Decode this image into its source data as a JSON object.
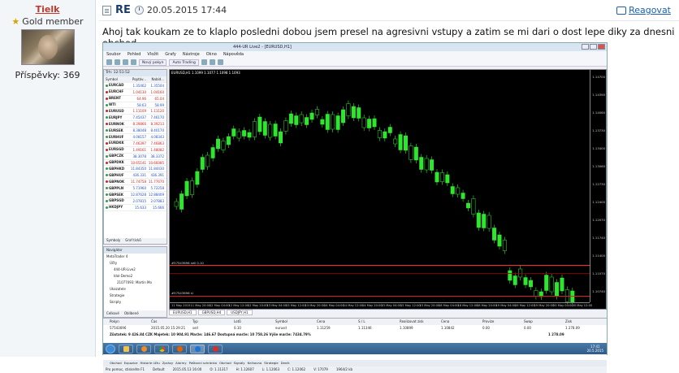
{
  "user": {
    "name": "Tielk",
    "rank": "Gold member",
    "posts_label": "Příspěvky: 369"
  },
  "post": {
    "prefix": "RE",
    "date": "20.05.2015 17:44",
    "reply_label": "Reagovat",
    "message": "Ahoj tak koukam ze to klaplo posledni dobou jsem presel na agresivni vstupy a zatim se mi dari o dost lepe diky za dnesni obchod."
  },
  "mt4": {
    "window_title": "444-UR Live2 - [EURUSD,H1]",
    "menu": [
      "Soubor",
      "Pohled",
      "Vložit",
      "Grafy",
      "Nástroje",
      "Okno",
      "Nápověda"
    ],
    "toolbar_buttons": [
      "Nový pokyn",
      "Auto Trading"
    ],
    "market_watch": {
      "header": "Trh: 12:51:52",
      "columns": [
        "Symbol",
        "Poptáv...",
        "Nabíd..."
      ],
      "rows": [
        {
          "symbol": "EURCAD",
          "bid": "1.35462",
          "ask": "1.35504",
          "dir": "up"
        },
        {
          "symbol": "EURCHF",
          "bid": "1.04130",
          "ask": "1.04160",
          "dir": "down"
        },
        {
          "symbol": "BRENT",
          "bid": "64.96",
          "ask": "65.04",
          "dir": "down"
        },
        {
          "symbol": "WTI",
          "bid": "58.63",
          "ask": "58.99",
          "dir": "up"
        },
        {
          "symbol": "EURUSD",
          "bid": "1.11109",
          "ask": "1.11120",
          "dir": "down"
        },
        {
          "symbol": "EURJPY",
          "bid": "7.45437",
          "ask": "7.46170",
          "dir": "up"
        },
        {
          "symbol": "EURNOK",
          "bid": "8.39866",
          "ask": "8.39213",
          "dir": "down"
        },
        {
          "symbol": "EURSEK",
          "bid": "8.38048",
          "ask": "8.40170",
          "dir": "up"
        },
        {
          "symbol": "EURHUF",
          "bid": "4.08157",
          "ask": "4.08343",
          "dir": "up"
        },
        {
          "symbol": "EURDKK",
          "bid": "7.46397",
          "ask": "7.46863",
          "dir": "down"
        },
        {
          "symbol": "EURSGD",
          "bid": "1.49161",
          "ask": "1.48082",
          "dir": "down"
        },
        {
          "symbol": "GBPCZK",
          "bid": "38.3078",
          "ask": "38.3372",
          "dir": "up"
        },
        {
          "symbol": "GBPDKK",
          "bid": "10.65141",
          "ask": "10.66085",
          "dir": "down"
        },
        {
          "symbol": "GBPHKD",
          "bid": "11.84350",
          "ask": "11.84430",
          "dir": "up"
        },
        {
          "symbol": "GBPHUF",
          "bid": "436.331",
          "ask": "436.391",
          "dir": "up"
        },
        {
          "symbol": "GBPNOK",
          "bid": "11.74758",
          "ask": "11.77670",
          "dir": "down"
        },
        {
          "symbol": "GBPPLN",
          "bid": "5.71960",
          "ask": "5.72258",
          "dir": "up"
        },
        {
          "symbol": "GBPSEK",
          "bid": "12.87628",
          "ask": "12.88409",
          "dir": "up"
        },
        {
          "symbol": "GBPSGD",
          "bid": "2.07815",
          "ask": "2.07883",
          "dir": "up"
        },
        {
          "symbol": "HKDJPY",
          "bid": "15.633",
          "ask": "15.666",
          "dir": "up"
        }
      ],
      "tabs": [
        "Symboly",
        "Graf ticků"
      ]
    },
    "navigator": {
      "title": "Navigátor",
      "items": [
        "MetaTrader 4",
        "Účty",
        "444-UR-Live2",
        "Idol-Demo2",
        "21077093: Martin Mo",
        "Ukazatele",
        "Strategie",
        "Skripty"
      ],
      "tabs": [
        "Celkové",
        "Oblíbené"
      ]
    },
    "chart": {
      "title": "EURUSD,H1  1.1099 1.1077 1.1098 1.1093",
      "price_ticks": [
        "1.14700",
        "1.14390",
        "1.14060",
        "1.13730",
        "1.13400",
        "1.13060",
        "1.12730",
        "1.12400",
        "1.12070",
        "1.11740",
        "1.11400",
        "1.11070",
        "1.10740"
      ],
      "time_ticks": [
        "11 May 2015",
        "11 May 20:00",
        "12 May 04:00",
        "12 May 12:00",
        "12 May 20:00",
        "13 May 04:00",
        "13 May 12:00",
        "13 May 20:00",
        "14 May 04:00",
        "14 May 12:00",
        "14 May 20:00",
        "15 May 04:00",
        "15 May 12:00",
        "15 May 20:00",
        "18 May 04:00",
        "18 May 12:00",
        "18 May 20:00",
        "19 May 04:00",
        "19 May 12:00",
        "19 May 20:00",
        "20 May 04:00",
        "20 May 12:00"
      ],
      "line_labels": [
        "#57543696 sell 0.10",
        "#57543696 sl"
      ],
      "tabs": [
        "EURUSD,H1",
        "GBPUSD,H4",
        "USDJPY,H1"
      ]
    },
    "terminal": {
      "columns": [
        "Pokyn",
        "Čas",
        "Typ",
        "Lotů",
        "Symbol",
        "Cena",
        "S / L",
        "Realizovat zisk",
        "Cena",
        "Provize",
        "Swap",
        "Zisk"
      ],
      "row": [
        "57543696",
        "2015.05.20 15:29:21",
        "sell",
        "0.10",
        "eurusd",
        "1.11259",
        "1.11346",
        "1.10899",
        "1.10842",
        "0.00",
        "0.00",
        "1 278.09"
      ],
      "summary": "Zůstatek: 9 426.84 CZK  Majetek: 10 904.91  Marže: 146.67  Dostupná marže: 10 758.26  Výše marže: 7434.79%",
      "summary_total": "1 278.09",
      "tabs": [
        "Obchod",
        "Expozice",
        "Historie účtu",
        "Zprávy",
        "Alarmy",
        "Poštovní schránka",
        "Obchod",
        "Signály",
        "Knihovna",
        "Strategie",
        "Deník"
      ]
    },
    "status": [
      "Pro pomoc, stiskněte F1",
      "Default",
      "2015.05.13 16:00",
      "O: 1.11317",
      "H: 1.12607",
      "L: 1.12063",
      "C: 1.12062",
      "V: 17079",
      "1964/2 kb"
    ],
    "clock": {
      "time": "17:41",
      "date": "20.5.2015"
    }
  },
  "colors": {
    "accent_link": "#1a5fb4",
    "username": "#c0392b",
    "candle": "#2ee62e",
    "sl_line": "#e02020",
    "sell_line": "#ff2b2b"
  }
}
